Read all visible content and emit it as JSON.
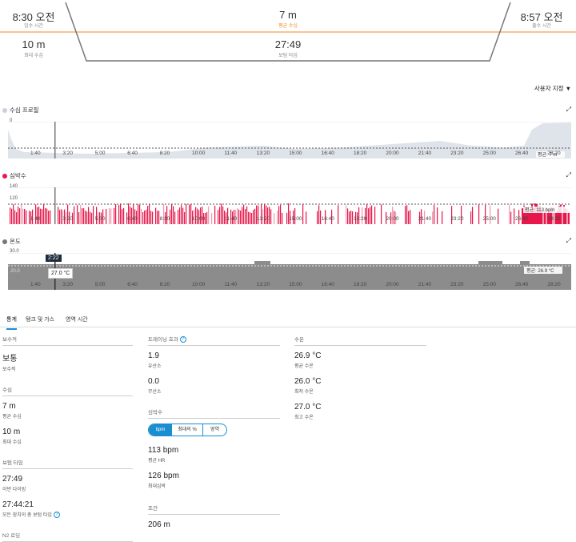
{
  "header": {
    "entry_time": "8:30 오전",
    "entry_label": "입수 시간",
    "avg_depth": "7 m",
    "avg_depth_label": "평균 수심",
    "exit_time": "8:57 오전",
    "exit_label": "출수 시간",
    "max_depth": "10 m",
    "max_depth_label": "최대 수심",
    "bottom_time": "27:49",
    "bottom_time_label": "보텀 타임"
  },
  "customize": "사용자 지정 ▼",
  "charts": {
    "depth": {
      "title": "수심 프로필",
      "y_top": "0",
      "y_bottom": "10",
      "avg": "평균: 7 m"
    },
    "hr": {
      "title": "심박수",
      "y_top": "140",
      "y_mid": "120",
      "avg": "평균: 113 bpm"
    },
    "temp": {
      "title": "온도",
      "y_top": "30.0",
      "y_mid": "20.0",
      "avg": "평균: 26.9 °C",
      "cursor_time": "2:22",
      "cursor_value": "27.0 °C"
    },
    "x_ticks": [
      "1:40",
      "3:20",
      "5:00",
      "6:40",
      "8:20",
      "10:00",
      "11:40",
      "13:20",
      "15:00",
      "16:40",
      "18:20",
      "20:00",
      "21:40",
      "23:20",
      "25:00",
      "26:40",
      "28:20"
    ]
  },
  "tabs": [
    "통계",
    "탱크 및 가스",
    "영역 시간"
  ],
  "col1": {
    "sections": [
      {
        "title": "보수적",
        "items": [
          {
            "value": "보통",
            "label": "보수적"
          }
        ]
      },
      {
        "title": "수심",
        "items": [
          {
            "value": "7 m",
            "label": "평균 수심"
          },
          {
            "value": "10 m",
            "label": "최대 수심"
          }
        ]
      },
      {
        "title": "보텀 타임",
        "items": [
          {
            "value": "27:49",
            "label": "이번 다이빙"
          },
          {
            "value": "27:44:21",
            "label": "모든 장치의 총 보텀 타임"
          }
        ]
      },
      {
        "title": "N2 로딩",
        "items": []
      }
    ]
  },
  "col2": {
    "training_title": "트레이닝 효과",
    "aerobic_value": "1.9",
    "aerobic_label": "유산소",
    "anaerobic_value": "0.0",
    "anaerobic_label": "무산소",
    "hr_title": "심박수",
    "hr_toggle": [
      "bpm",
      "최대의 %",
      "영역"
    ],
    "avg_hr_value": "113 bpm",
    "avg_hr_label": "평균 HR",
    "max_hr_value": "126 bpm",
    "max_hr_label": "최대심박",
    "cond_title": "조건",
    "cond_value": "206 m"
  },
  "col3": {
    "title": "수온",
    "items": [
      {
        "value": "26.9 °C",
        "label": "평균 수온"
      },
      {
        "value": "26.0 °C",
        "label": "최저 수온"
      },
      {
        "value": "27.0 °C",
        "label": "최고 수온"
      }
    ]
  },
  "colors": {
    "accent": "#f08a1c",
    "hr": "#e8164a",
    "temp": "#8c8c8c",
    "depth": "#dfe4ea",
    "blue": "#1a8fd0"
  }
}
